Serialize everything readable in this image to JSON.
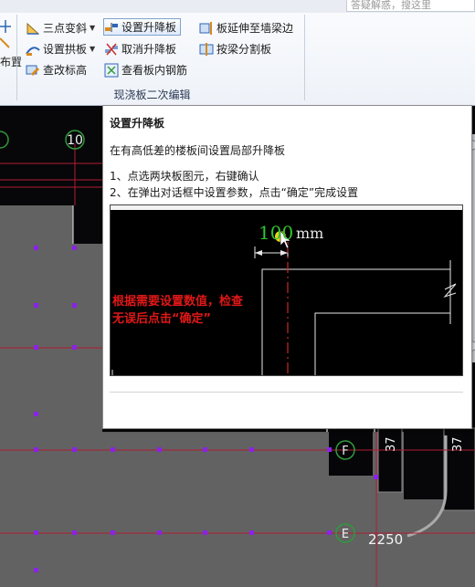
{
  "ribbon": {
    "search_placeholder": "答疑解惑，搜这里",
    "left_partial_label": "布置",
    "buttons": {
      "three_point_slope": "三点变斜",
      "set_raise_lower_slab": "设置升降板",
      "slab_extend_to_wall_beam": "板延伸至墙梁边",
      "set_arch_slab": "设置拱板",
      "cancel_raise_lower_slab": "取消升降板",
      "split_by_beam": "按梁分割板",
      "check_elevation": "查改标高",
      "view_slab_rebar": "查看板内钢筋"
    },
    "group_label": "现浇板二次编辑"
  },
  "canvas": {
    "axis_labels": {
      "top_number": "10",
      "row_f": "F",
      "row_e": "E"
    },
    "dimension_text": "2250",
    "side_dim_1": "37",
    "side_dim_2": "37"
  },
  "tooltip": {
    "title": "设置升降板",
    "description": "在有高低差的楼板间设置局部升降板",
    "step1": "1、点选两块板图元，右键确认",
    "step2": "2、在弹出对话框中设置参数，点击“确定”完成设置",
    "preview": {
      "value": "100",
      "unit": "mm",
      "hint": "根据需要设置数值，检查无误后点击“确定”"
    }
  },
  "colors": {
    "canvas_bg": "#070709",
    "slab_gray": "#626262",
    "purple_point": "#8b22e8",
    "red_line": "#b01c34",
    "axis_green": "#2f9a3c",
    "hint_red": "#e01818",
    "value_green": "#31c431"
  }
}
